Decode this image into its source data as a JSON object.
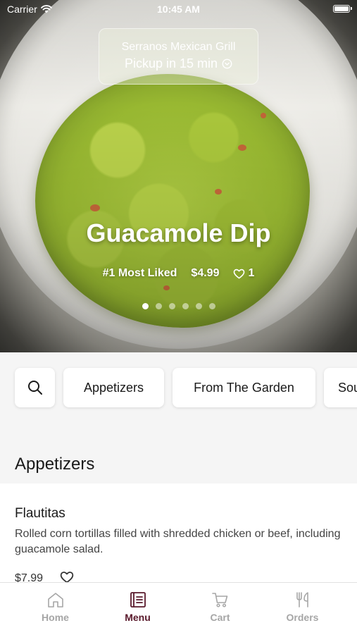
{
  "status_bar": {
    "carrier": "Carrier",
    "time": "10:45 AM"
  },
  "pickup": {
    "restaurant": "Serranos Mexican Grill",
    "eta": "Pickup in 15 min"
  },
  "hero": {
    "title": "Guacamole Dip",
    "rank": "#1 Most Liked",
    "price": "$4.99",
    "likes": "1",
    "page_dots": 6,
    "active_dot": 1
  },
  "categories": [
    "Appetizers",
    "From The Garden",
    "Sou"
  ],
  "section": {
    "title": "Appetizers"
  },
  "item": {
    "name": "Flautitas",
    "description": "Rolled corn tortillas filled with shredded chicken or beef, including guacamole salad.",
    "price": "$7.99"
  },
  "tabs": [
    {
      "label": "Home",
      "icon": "home-icon",
      "active": false
    },
    {
      "label": "Menu",
      "icon": "menu-book-icon",
      "active": true
    },
    {
      "label": "Cart",
      "icon": "cart-icon",
      "active": false
    },
    {
      "label": "Orders",
      "icon": "fork-knife-icon",
      "active": false
    }
  ],
  "colors": {
    "accent": "#5a1a2c",
    "inactive_tab": "#a6a6a6",
    "background": "#f5f5f5"
  }
}
